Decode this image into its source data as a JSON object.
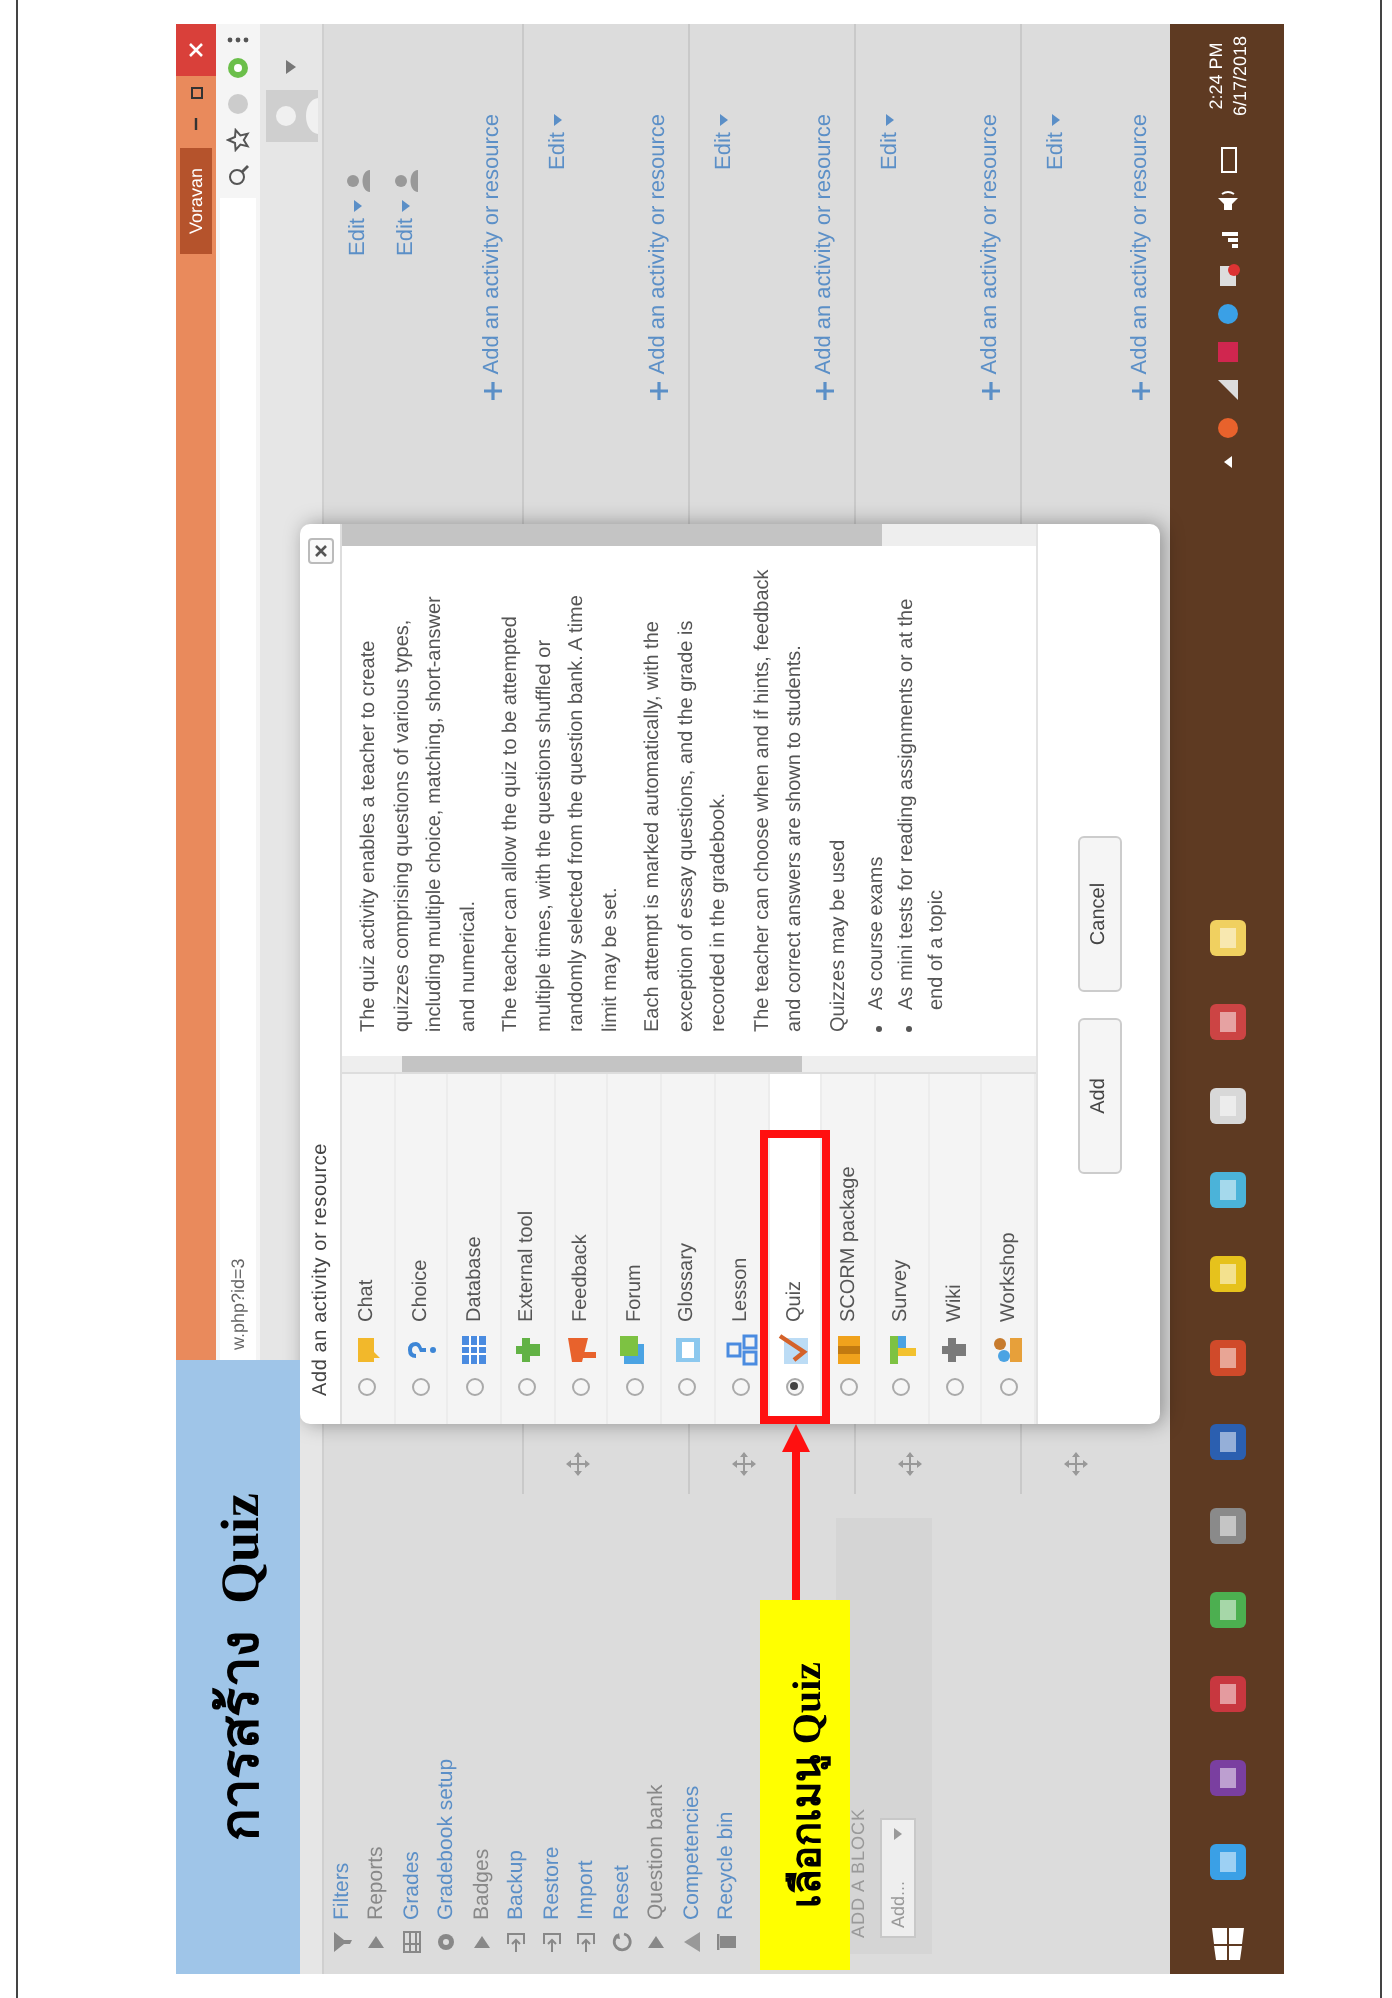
{
  "annotations": {
    "title_callout": "การสร้าง  Quiz",
    "pointer_callout": "เลือกเมนู Quiz"
  },
  "browser": {
    "profile": "Voravan",
    "url": "w.php?id=3"
  },
  "sidebar": {
    "items": [
      {
        "label": "Filters",
        "kind": "funnel"
      },
      {
        "label": "Reports",
        "kind": "branch"
      },
      {
        "label": "Grades",
        "kind": "grid"
      },
      {
        "label": "Gradebook setup",
        "kind": "gear"
      },
      {
        "label": "Badges",
        "kind": "branch"
      },
      {
        "label": "Backup",
        "kind": "box-arrow"
      },
      {
        "label": "Restore",
        "kind": "box-arrow"
      },
      {
        "label": "Import",
        "kind": "box-arrow"
      },
      {
        "label": "Reset",
        "kind": "cycle"
      },
      {
        "label": "Question bank",
        "kind": "branch"
      },
      {
        "label": "Competencies",
        "kind": "mountain"
      },
      {
        "label": "Recycle bin",
        "kind": "bin"
      }
    ],
    "add_block": {
      "title": "ADD A BLOCK",
      "value": "Add..."
    }
  },
  "sections": [
    {
      "movable": false,
      "edits": [
        {
          "label": "Edit",
          "kind": "with-user"
        },
        {
          "label": "Edit",
          "kind": "with-user"
        }
      ],
      "add_link": "Add an activity or resource"
    },
    {
      "movable": true,
      "edits": [
        {
          "label": "Edit",
          "kind": "plain"
        }
      ],
      "add_link": "Add an activity or resource"
    },
    {
      "movable": true,
      "edits": [
        {
          "label": "Edit",
          "kind": "plain"
        }
      ],
      "add_link": "Add an activity or resource"
    },
    {
      "movable": true,
      "edits": [
        {
          "label": "Edit",
          "kind": "plain"
        }
      ],
      "add_link": "Add an activity or resource"
    },
    {
      "movable": true,
      "edits": [
        {
          "label": "Edit",
          "kind": "plain"
        }
      ],
      "add_link": "Add an activity or resource"
    }
  ],
  "dialog": {
    "title": "Add an activity or resource",
    "modules": [
      {
        "label": "Chat",
        "kind": "chat",
        "selected": false
      },
      {
        "label": "Choice",
        "kind": "choice",
        "selected": false
      },
      {
        "label": "Database",
        "kind": "database",
        "selected": false
      },
      {
        "label": "External tool",
        "kind": "puzzle",
        "selected": false
      },
      {
        "label": "Feedback",
        "kind": "megaphone",
        "selected": false
      },
      {
        "label": "Forum",
        "kind": "forum",
        "selected": false
      },
      {
        "label": "Glossary",
        "kind": "book",
        "selected": false
      },
      {
        "label": "Lesson",
        "kind": "lesson",
        "selected": false
      },
      {
        "label": "Quiz",
        "kind": "quiz",
        "selected": true
      },
      {
        "label": "SCORM package",
        "kind": "package",
        "selected": false
      },
      {
        "label": "Survey",
        "kind": "survey",
        "selected": false
      },
      {
        "label": "Wiki",
        "kind": "wiki",
        "selected": false
      },
      {
        "label": "Workshop",
        "kind": "workshop",
        "selected": false
      }
    ],
    "description": [
      {
        "kind": "paragraph",
        "text": "The quiz activity enables a teacher to create quizzes comprising questions of various types, including multiple choice, matching, short-answer and numerical."
      },
      {
        "kind": "paragraph",
        "text": "The teacher can allow the quiz to be attempted multiple times, with the questions shuffled or randomly selected from the question bank. A time limit may be set."
      },
      {
        "kind": "paragraph",
        "text": "Each attempt is marked automatically, with the exception of essay questions, and the grade is recorded in the gradebook."
      },
      {
        "kind": "paragraph",
        "text": "The teacher can choose when and if hints, feedback and correct answers are shown to students."
      },
      {
        "kind": "paragraph",
        "text": "Quizzes may be used"
      },
      {
        "kind": "bullet",
        "text": "As course exams"
      },
      {
        "kind": "bullet",
        "text": "As mini tests for reading assignments or at the end of a topic"
      }
    ],
    "buttons": [
      "Add",
      "Cancel"
    ]
  },
  "taskbar": {
    "time": "2:24 PM",
    "date": "6/17/2018"
  }
}
